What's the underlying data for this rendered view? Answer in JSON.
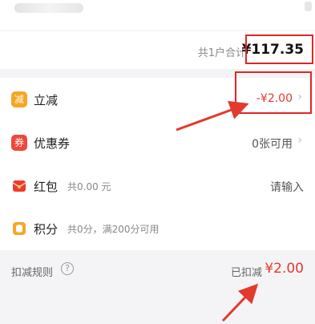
{
  "summary": {
    "total_label": "共1户合计",
    "total_value": "¥117.35"
  },
  "rows": {
    "instant": {
      "icon_text": "减",
      "label": "立减",
      "value": "-¥2.00"
    },
    "coupon": {
      "icon_text": "券",
      "label": "优惠券",
      "value": "0张可用"
    },
    "hongbao": {
      "label": "红包",
      "sub": "共0.00 元",
      "value": "请输入"
    },
    "points": {
      "label": "积分",
      "sub": "共0分，满200分可用"
    }
  },
  "footer": {
    "rules_label": "扣减规则",
    "help_symbol": "?",
    "deducted_label": "已扣减",
    "deducted_value": "¥2.00"
  },
  "colors": {
    "accent_red": "#e23a2e",
    "annotation_red": "#e02626",
    "instant_icon": "#f5a623",
    "coupon_icon": "#f0473b",
    "hongbao_icon": "#ef3b2d",
    "points_icon": "#f5a623"
  },
  "icons": {
    "instant": "discount-badge-icon",
    "coupon": "coupon-ticket-icon",
    "hongbao": "red-envelope-icon",
    "points": "coin-stack-icon",
    "chevron": "chevron-right-icon",
    "help": "question-circle-icon"
  }
}
